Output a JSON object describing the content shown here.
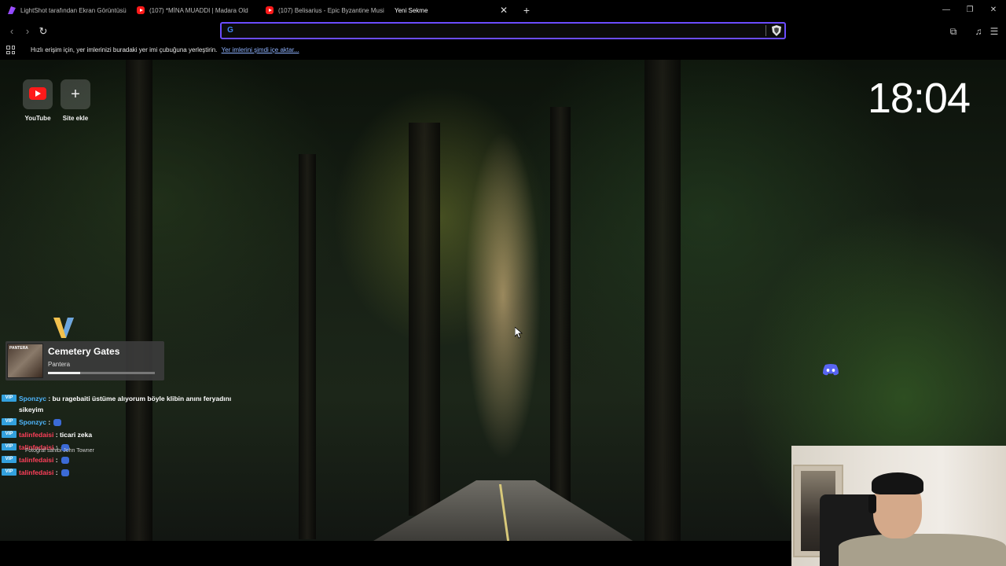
{
  "tabs": [
    {
      "title": "LightShot tarafından Ekran Görüntüsü",
      "icon": "lightshot-icon"
    },
    {
      "title": "(107) *MİNA MUADDI | Madara Old",
      "icon": "youtube-icon"
    },
    {
      "title": "(107) Belisarius - Epic Byzantine Musi",
      "icon": "youtube-icon"
    },
    {
      "title": "Yeni Sekme",
      "icon": "",
      "active": true
    }
  ],
  "toolbar": {
    "omnibox_value": "",
    "omnibox_placeholder": ""
  },
  "bookmarks": {
    "hint_text": "Hızlı erişim için, yer imlerinizi buradaki yer imi çubuğuna yerleştirin.",
    "import_link": "Yer imlerini şimdi içe aktar..."
  },
  "speed_dial": [
    {
      "label": "YouTube",
      "icon": "youtube-icon"
    },
    {
      "label": "Site ekle",
      "icon": "plus-icon"
    }
  ],
  "clock": "18:04",
  "now_playing": {
    "title": "Cemetery Gates",
    "artist": "Pantera",
    "art_text": "PANTERA",
    "progress": 0.3
  },
  "photo_credit": "Fotoğraf sahibi John Towner",
  "chat": [
    {
      "badge": "VIP",
      "user": "Sponzyc",
      "user_color": "blue",
      "text": ": bu ragebaiti üstüme alıyorum böyle klibin anını feryadını sikeyim",
      "emote": false
    },
    {
      "badge": "VIP",
      "user": "Sponzyc",
      "user_color": "blue",
      "text": ":",
      "emote": true
    },
    {
      "badge": "VIP",
      "user": "talinfedaisi",
      "user_color": "red",
      "text": ": ticari zeka",
      "emote": false
    },
    {
      "badge": "VIP",
      "user": "talinfedaisi",
      "user_color": "red",
      "text": ":",
      "emote": true
    },
    {
      "badge": "VIP",
      "user": "talinfedaisi",
      "user_color": "red",
      "text": ":",
      "emote": true
    },
    {
      "badge": "VIP",
      "user": "talinfedaisi",
      "user_color": "red",
      "text": ":",
      "emote": true
    }
  ],
  "colors": {
    "omnibox_border": "#6b4cff",
    "link": "#8fb3ff",
    "chat_blue": "#4fb7ff",
    "chat_red": "#ff3f5a",
    "discord": "#5865f2"
  }
}
